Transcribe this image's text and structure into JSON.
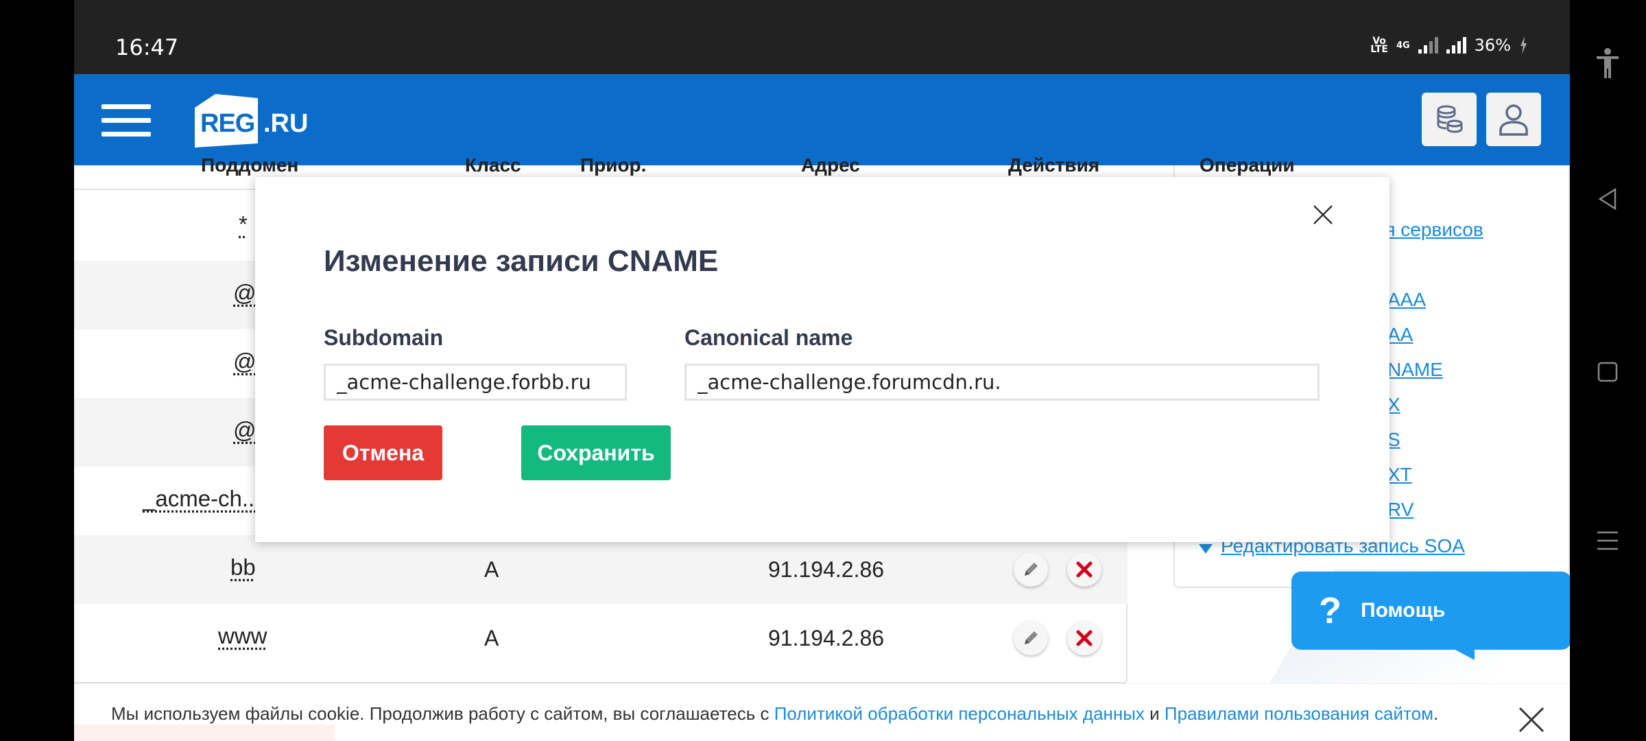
{
  "status_bar": {
    "time": "16:47",
    "volte": "Vo LTE",
    "network": "4G",
    "battery": "36%"
  },
  "header": {
    "logo_badge": "REG",
    "logo_suffix": ".RU",
    "menu_icon": "hamburger-icon",
    "wallet_icon": "coins-icon",
    "profile_icon": "user-icon",
    "brand_color": "#0b6dc9"
  },
  "table": {
    "headers": [
      "Поддомен",
      "Класс",
      "Приор.",
      "Адрес",
      "Действия"
    ],
    "rows": [
      {
        "subdomain": "*",
        "class": "",
        "address": ""
      },
      {
        "subdomain": "@",
        "class": "",
        "address": ""
      },
      {
        "subdomain": "@",
        "class": "",
        "address": ""
      },
      {
        "subdomain": "@",
        "class": "",
        "address": ""
      },
      {
        "subdomain": "_acme-ch...",
        "class": "",
        "address": ""
      },
      {
        "subdomain": "bb",
        "class": "A",
        "address": "91.194.2.86"
      },
      {
        "subdomain": "www",
        "class": "A",
        "address": "91.194.2.86"
      }
    ]
  },
  "side_panel": {
    "title": "Операции",
    "links": [
      "ля сервисов",
      "AAA",
      "AA",
      "NAME",
      "X",
      "S",
      "XT",
      "RV",
      "Редактировать запись SOA"
    ]
  },
  "help": {
    "icon": "?",
    "label": "Помощь"
  },
  "cookie": {
    "text": "Мы используем файлы cookie. Продолжив работу с сайтом, вы соглашаетесь с ",
    "link1": "Политикой обработки персональных данных",
    "mid": " и ",
    "link2": "Правилами пользования сайтом",
    "end": "."
  },
  "modal": {
    "title": "Изменение записи CNAME",
    "subdomain_label": "Subdomain",
    "subdomain_value": "_acme-challenge.forbb.ru",
    "canonical_label": "Canonical name",
    "canonical_value": "_acme-challenge.forumcdn.ru.",
    "cancel_label": "Отмена",
    "save_label": "Сохранить",
    "cancel_color": "#e53935",
    "save_color": "#13b97f"
  },
  "navbar": {
    "icons": [
      "accessibility-icon",
      "back-icon",
      "home-icon",
      "recents-icon"
    ]
  }
}
